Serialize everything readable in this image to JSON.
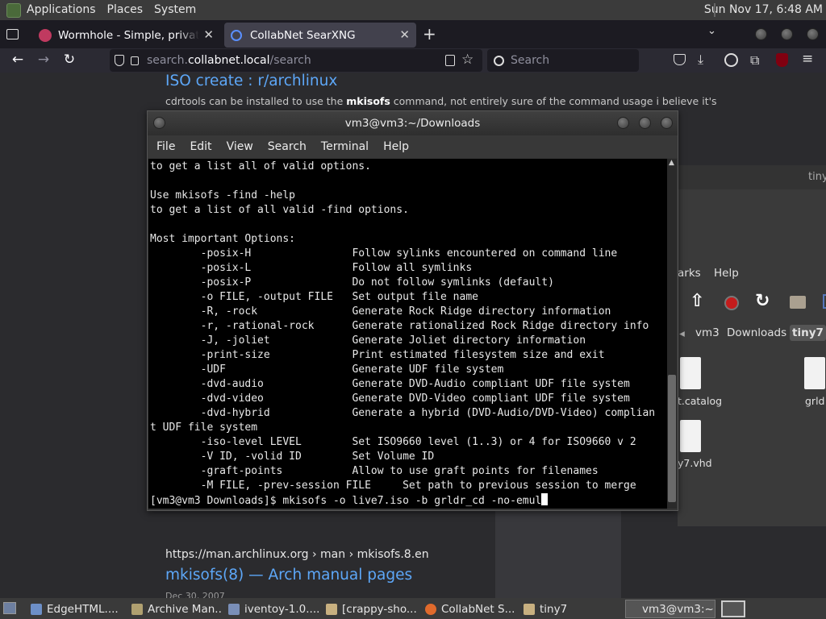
{
  "top_panel": {
    "menus": [
      "Applications",
      "Places",
      "System"
    ],
    "clock": "Sun Nov 17,  6:48 AM"
  },
  "browser": {
    "tabs": [
      {
        "label": "Wormhole - Simple, private fil",
        "favicon": "wormhole-icon",
        "color": "#c03a60"
      },
      {
        "label": "CollabNet SearXNG",
        "favicon": "search-icon",
        "color": "#3b6fd8"
      }
    ],
    "url_host": "search.",
    "url_domain": "collabnet.local",
    "url_path": "/search",
    "search_placeholder": "Search"
  },
  "results": [
    {
      "title": "ISO create : r/archlinux",
      "snippet_pre": "cdrtools can be installed to use the ",
      "snippet_bold": "mkisofs",
      "snippet_post": " command, not entirely sure of the command usage i believe it's"
    },
    {
      "url": "https://man.archlinux.org  › man › mkisofs.8.en",
      "title": "mkisofs(8) — Arch manual pages",
      "date": "Dec 30, 2007"
    }
  ],
  "file_manager": {
    "title": "tiny",
    "menus": [
      "arks",
      "Help"
    ],
    "path": [
      "vm3",
      "Downloads",
      "tiny7"
    ],
    "files": [
      "t.catalog",
      "grld",
      "y7.vhd"
    ]
  },
  "terminal": {
    "title": "vm3@vm3:~/Downloads",
    "menus": [
      "File",
      "Edit",
      "View",
      "Search",
      "Terminal",
      "Help"
    ],
    "lines": [
      "to get a list all of valid options.",
      "",
      "Use mkisofs -find -help",
      "to get a list of all valid -find options.",
      "",
      "Most important Options:",
      "        -posix-H                Follow sylinks encountered on command line",
      "        -posix-L                Follow all symlinks",
      "        -posix-P                Do not follow symlinks (default)",
      "        -o FILE, -output FILE   Set output file name",
      "        -R, -rock               Generate Rock Ridge directory information",
      "        -r, -rational-rock      Generate rationalized Rock Ridge directory info",
      "        -J, -joliet             Generate Joliet directory information",
      "        -print-size             Print estimated filesystem size and exit",
      "        -UDF                    Generate UDF file system",
      "        -dvd-audio              Generate DVD-Audio compliant UDF file system",
      "        -dvd-video              Generate DVD-Video compliant UDF file system",
      "        -dvd-hybrid             Generate a hybrid (DVD-Audio/DVD-Video) complian",
      "t UDF file system",
      "        -iso-level LEVEL        Set ISO9660 level (1..3) or 4 for ISO9660 v 2",
      "        -V ID, -volid ID        Set Volume ID",
      "        -graft-points           Allow to use graft points for filenames",
      "        -M FILE, -prev-session FILE     Set path to previous session to merge"
    ],
    "prompt": "[vm3@vm3 Downloads]$ mkisofs -o live7.iso -b grldr_cd -no-emul"
  },
  "taskbar": [
    {
      "label": "EdgeHTML....",
      "icon": "document-icon",
      "color": "#6d8fc7"
    },
    {
      "label": "Archive Man...",
      "icon": "archive-icon",
      "color": "#b0a070"
    },
    {
      "label": "iventoy-1.0....",
      "icon": "archive-icon",
      "color": "#7a8fb8"
    },
    {
      "label": "[crappy-sho...",
      "icon": "folder-icon",
      "color": "#c8b080"
    },
    {
      "label": "CollabNet S...",
      "icon": "firefox-icon",
      "color": "#e06a2c"
    },
    {
      "label": "tiny7",
      "icon": "folder-icon",
      "color": "#c8b080"
    },
    {
      "label": "vm3@vm3:~...",
      "icon": "terminal-icon",
      "color": "#555"
    }
  ]
}
